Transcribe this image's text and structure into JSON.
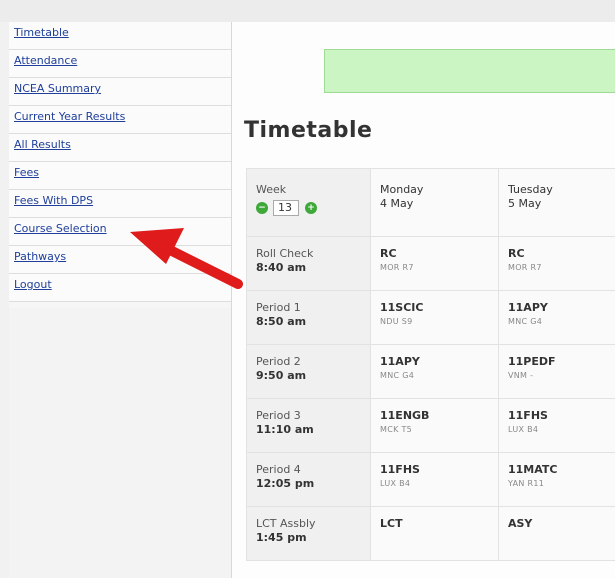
{
  "sidebar": {
    "items": [
      {
        "label": "Timetable"
      },
      {
        "label": "Attendance"
      },
      {
        "label": "NCEA Summary"
      },
      {
        "label": "Current Year Results"
      },
      {
        "label": "All Results"
      },
      {
        "label": "Fees"
      },
      {
        "label": "Fees With DPS"
      },
      {
        "label": "Course Selection"
      },
      {
        "label": "Pathways"
      },
      {
        "label": "Logout"
      }
    ]
  },
  "main": {
    "title": "Timetable"
  },
  "timetable": {
    "week_label": "Week",
    "week_value": "13",
    "days": [
      {
        "name": "Monday",
        "date": "4 May"
      },
      {
        "name": "Tuesday",
        "date": "5 May"
      }
    ],
    "rows": [
      {
        "period": "Roll Check",
        "time": "8:40 am",
        "cells": [
          {
            "code": "RC",
            "room": "MOR R7"
          },
          {
            "code": "RC",
            "room": "MOR R7"
          }
        ]
      },
      {
        "period": "Period 1",
        "time": "8:50 am",
        "cells": [
          {
            "code": "11SCIC",
            "room": "NDU S9"
          },
          {
            "code": "11APY",
            "room": "MNC G4"
          }
        ]
      },
      {
        "period": "Period 2",
        "time": "9:50 am",
        "cells": [
          {
            "code": "11APY",
            "room": "MNC G4"
          },
          {
            "code": "11PEDF",
            "room": "VNM -"
          }
        ]
      },
      {
        "period": "Period 3",
        "time": "11:10 am",
        "cells": [
          {
            "code": "11ENGB",
            "room": "MCK T5"
          },
          {
            "code": "11FHS",
            "room": "LUX B4"
          }
        ]
      },
      {
        "period": "Period 4",
        "time": "12:05 pm",
        "cells": [
          {
            "code": "11FHS",
            "room": "LUX B4"
          },
          {
            "code": "11MATC",
            "room": "YAN R11"
          }
        ]
      },
      {
        "period": "LCT Assbly",
        "time": "1:45 pm",
        "cells": [
          {
            "code": "LCT",
            "room": ""
          },
          {
            "code": "ASY",
            "room": ""
          }
        ]
      }
    ]
  },
  "colors": {
    "link": "#1f3f9a",
    "banner": "#ccf5c4",
    "arrow": "#e01b1b",
    "stepper": "#3ea83a"
  }
}
